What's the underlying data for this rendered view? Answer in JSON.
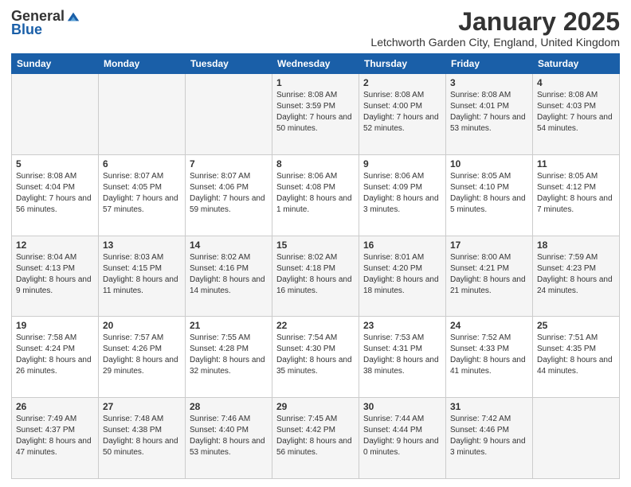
{
  "logo": {
    "general": "General",
    "blue": "Blue"
  },
  "header": {
    "month": "January 2025",
    "location": "Letchworth Garden City, England, United Kingdom"
  },
  "weekdays": [
    "Sunday",
    "Monday",
    "Tuesday",
    "Wednesday",
    "Thursday",
    "Friday",
    "Saturday"
  ],
  "weeks": [
    [
      {
        "day": "",
        "sunrise": "",
        "sunset": "",
        "daylight": ""
      },
      {
        "day": "",
        "sunrise": "",
        "sunset": "",
        "daylight": ""
      },
      {
        "day": "",
        "sunrise": "",
        "sunset": "",
        "daylight": ""
      },
      {
        "day": "1",
        "sunrise": "Sunrise: 8:08 AM",
        "sunset": "Sunset: 3:59 PM",
        "daylight": "Daylight: 7 hours and 50 minutes."
      },
      {
        "day": "2",
        "sunrise": "Sunrise: 8:08 AM",
        "sunset": "Sunset: 4:00 PM",
        "daylight": "Daylight: 7 hours and 52 minutes."
      },
      {
        "day": "3",
        "sunrise": "Sunrise: 8:08 AM",
        "sunset": "Sunset: 4:01 PM",
        "daylight": "Daylight: 7 hours and 53 minutes."
      },
      {
        "day": "4",
        "sunrise": "Sunrise: 8:08 AM",
        "sunset": "Sunset: 4:03 PM",
        "daylight": "Daylight: 7 hours and 54 minutes."
      }
    ],
    [
      {
        "day": "5",
        "sunrise": "Sunrise: 8:08 AM",
        "sunset": "Sunset: 4:04 PM",
        "daylight": "Daylight: 7 hours and 56 minutes."
      },
      {
        "day": "6",
        "sunrise": "Sunrise: 8:07 AM",
        "sunset": "Sunset: 4:05 PM",
        "daylight": "Daylight: 7 hours and 57 minutes."
      },
      {
        "day": "7",
        "sunrise": "Sunrise: 8:07 AM",
        "sunset": "Sunset: 4:06 PM",
        "daylight": "Daylight: 7 hours and 59 minutes."
      },
      {
        "day": "8",
        "sunrise": "Sunrise: 8:06 AM",
        "sunset": "Sunset: 4:08 PM",
        "daylight": "Daylight: 8 hours and 1 minute."
      },
      {
        "day": "9",
        "sunrise": "Sunrise: 8:06 AM",
        "sunset": "Sunset: 4:09 PM",
        "daylight": "Daylight: 8 hours and 3 minutes."
      },
      {
        "day": "10",
        "sunrise": "Sunrise: 8:05 AM",
        "sunset": "Sunset: 4:10 PM",
        "daylight": "Daylight: 8 hours and 5 minutes."
      },
      {
        "day": "11",
        "sunrise": "Sunrise: 8:05 AM",
        "sunset": "Sunset: 4:12 PM",
        "daylight": "Daylight: 8 hours and 7 minutes."
      }
    ],
    [
      {
        "day": "12",
        "sunrise": "Sunrise: 8:04 AM",
        "sunset": "Sunset: 4:13 PM",
        "daylight": "Daylight: 8 hours and 9 minutes."
      },
      {
        "day": "13",
        "sunrise": "Sunrise: 8:03 AM",
        "sunset": "Sunset: 4:15 PM",
        "daylight": "Daylight: 8 hours and 11 minutes."
      },
      {
        "day": "14",
        "sunrise": "Sunrise: 8:02 AM",
        "sunset": "Sunset: 4:16 PM",
        "daylight": "Daylight: 8 hours and 14 minutes."
      },
      {
        "day": "15",
        "sunrise": "Sunrise: 8:02 AM",
        "sunset": "Sunset: 4:18 PM",
        "daylight": "Daylight: 8 hours and 16 minutes."
      },
      {
        "day": "16",
        "sunrise": "Sunrise: 8:01 AM",
        "sunset": "Sunset: 4:20 PM",
        "daylight": "Daylight: 8 hours and 18 minutes."
      },
      {
        "day": "17",
        "sunrise": "Sunrise: 8:00 AM",
        "sunset": "Sunset: 4:21 PM",
        "daylight": "Daylight: 8 hours and 21 minutes."
      },
      {
        "day": "18",
        "sunrise": "Sunrise: 7:59 AM",
        "sunset": "Sunset: 4:23 PM",
        "daylight": "Daylight: 8 hours and 24 minutes."
      }
    ],
    [
      {
        "day": "19",
        "sunrise": "Sunrise: 7:58 AM",
        "sunset": "Sunset: 4:24 PM",
        "daylight": "Daylight: 8 hours and 26 minutes."
      },
      {
        "day": "20",
        "sunrise": "Sunrise: 7:57 AM",
        "sunset": "Sunset: 4:26 PM",
        "daylight": "Daylight: 8 hours and 29 minutes."
      },
      {
        "day": "21",
        "sunrise": "Sunrise: 7:55 AM",
        "sunset": "Sunset: 4:28 PM",
        "daylight": "Daylight: 8 hours and 32 minutes."
      },
      {
        "day": "22",
        "sunrise": "Sunrise: 7:54 AM",
        "sunset": "Sunset: 4:30 PM",
        "daylight": "Daylight: 8 hours and 35 minutes."
      },
      {
        "day": "23",
        "sunrise": "Sunrise: 7:53 AM",
        "sunset": "Sunset: 4:31 PM",
        "daylight": "Daylight: 8 hours and 38 minutes."
      },
      {
        "day": "24",
        "sunrise": "Sunrise: 7:52 AM",
        "sunset": "Sunset: 4:33 PM",
        "daylight": "Daylight: 8 hours and 41 minutes."
      },
      {
        "day": "25",
        "sunrise": "Sunrise: 7:51 AM",
        "sunset": "Sunset: 4:35 PM",
        "daylight": "Daylight: 8 hours and 44 minutes."
      }
    ],
    [
      {
        "day": "26",
        "sunrise": "Sunrise: 7:49 AM",
        "sunset": "Sunset: 4:37 PM",
        "daylight": "Daylight: 8 hours and 47 minutes."
      },
      {
        "day": "27",
        "sunrise": "Sunrise: 7:48 AM",
        "sunset": "Sunset: 4:38 PM",
        "daylight": "Daylight: 8 hours and 50 minutes."
      },
      {
        "day": "28",
        "sunrise": "Sunrise: 7:46 AM",
        "sunset": "Sunset: 4:40 PM",
        "daylight": "Daylight: 8 hours and 53 minutes."
      },
      {
        "day": "29",
        "sunrise": "Sunrise: 7:45 AM",
        "sunset": "Sunset: 4:42 PM",
        "daylight": "Daylight: 8 hours and 56 minutes."
      },
      {
        "day": "30",
        "sunrise": "Sunrise: 7:44 AM",
        "sunset": "Sunset: 4:44 PM",
        "daylight": "Daylight: 9 hours and 0 minutes."
      },
      {
        "day": "31",
        "sunrise": "Sunrise: 7:42 AM",
        "sunset": "Sunset: 4:46 PM",
        "daylight": "Daylight: 9 hours and 3 minutes."
      },
      {
        "day": "",
        "sunrise": "",
        "sunset": "",
        "daylight": ""
      }
    ]
  ]
}
